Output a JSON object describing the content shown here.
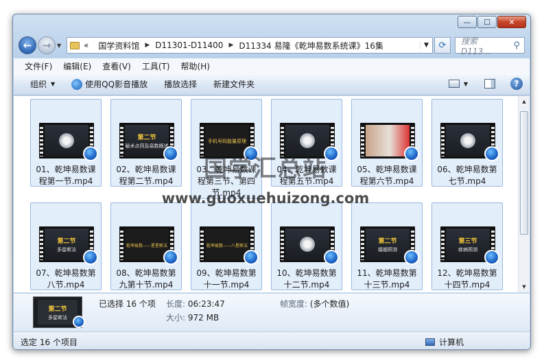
{
  "window": {
    "min_label": "—",
    "max_label": "☐",
    "close_label": "✕"
  },
  "nav": {
    "back_glyph": "←",
    "fwd_glyph": "→"
  },
  "address": {
    "overflow": "«",
    "crumbs": [
      "国学资料馆",
      "D11301-D11400",
      "D11334 易隆《乾坤易数系统课》16集"
    ]
  },
  "search": {
    "placeholder": "搜索 D113..."
  },
  "menu": [
    "文件(F)",
    "编辑(E)",
    "查看(V)",
    "工具(T)",
    "帮助(H)"
  ],
  "toolbar": {
    "organize": "组织",
    "play_with_qq": "使用QQ影音播放",
    "play_selection": "播放选择",
    "new_folder": "新建文件夹",
    "help": "?"
  },
  "files": [
    {
      "line1": "01、乾坤易数课",
      "line2": "程第一节.mp4",
      "thumb_title": "",
      "thumb_sub": ""
    },
    {
      "line1": "02、乾坤易数课",
      "line2": "程第二节.mp4",
      "thumb_title": "第二节",
      "thumb_sub": "秘术点窍及易数概述"
    },
    {
      "line1": "03、乾坤易数课",
      "line2": "程第三节、第四",
      "line3": "节.mp4",
      "thumb_title": "手机号码能量原理",
      "thumb_sub": ""
    },
    {
      "line1": "04、乾坤易数课",
      "line2": "程第五节.mp4",
      "thumb_title": "",
      "thumb_sub": ""
    },
    {
      "line1": "05、乾坤易数课",
      "line2": "程第六节.mp4",
      "thumb_title": "",
      "thumb_sub": ""
    },
    {
      "line1": "06、乾坤易数第",
      "line2": "七节.mp4",
      "thumb_title": "",
      "thumb_sub": ""
    },
    {
      "line1": "07、乾坤易数第",
      "line2": "八节.mp4",
      "thumb_title": "第二节",
      "thumb_sub": "多星断法"
    },
    {
      "line1": "08、乾坤易数第",
      "line2": "九第十节.mp4",
      "thumb_title": "乾坤易数——星星断法",
      "thumb_sub": ""
    },
    {
      "line1": "09、乾坤易数第",
      "line2": "十一节.mp4",
      "thumb_title": "乾坤易数——八星断法",
      "thumb_sub": ""
    },
    {
      "line1": "10、乾坤易数第",
      "line2": "十二节.mp4",
      "thumb_title": "",
      "thumb_sub": ""
    },
    {
      "line1": "11、乾坤易数第",
      "line2": "十三节.mp4",
      "thumb_title": "第二节",
      "thumb_sub": "婚姻预测"
    },
    {
      "line1": "12、乾坤易数第",
      "line2": "十四节.mp4",
      "thumb_title": "第三节",
      "thumb_sub": "疾病预测"
    }
  ],
  "watermark": {
    "big": "国学汇总站",
    "url": "www.guoxuehuizong.com"
  },
  "details": {
    "selected": "已选择 16 个项",
    "length_key": "长度:",
    "length_val": "06:23:47",
    "size_key": "大小:",
    "size_val": "972 MB",
    "width_key": "帧宽度:",
    "width_val": "(多个数值)",
    "thumb_title": "第二节",
    "thumb_sub": "多星断法"
  },
  "status": {
    "left": "选定 16 个项目",
    "right": "计算机"
  }
}
